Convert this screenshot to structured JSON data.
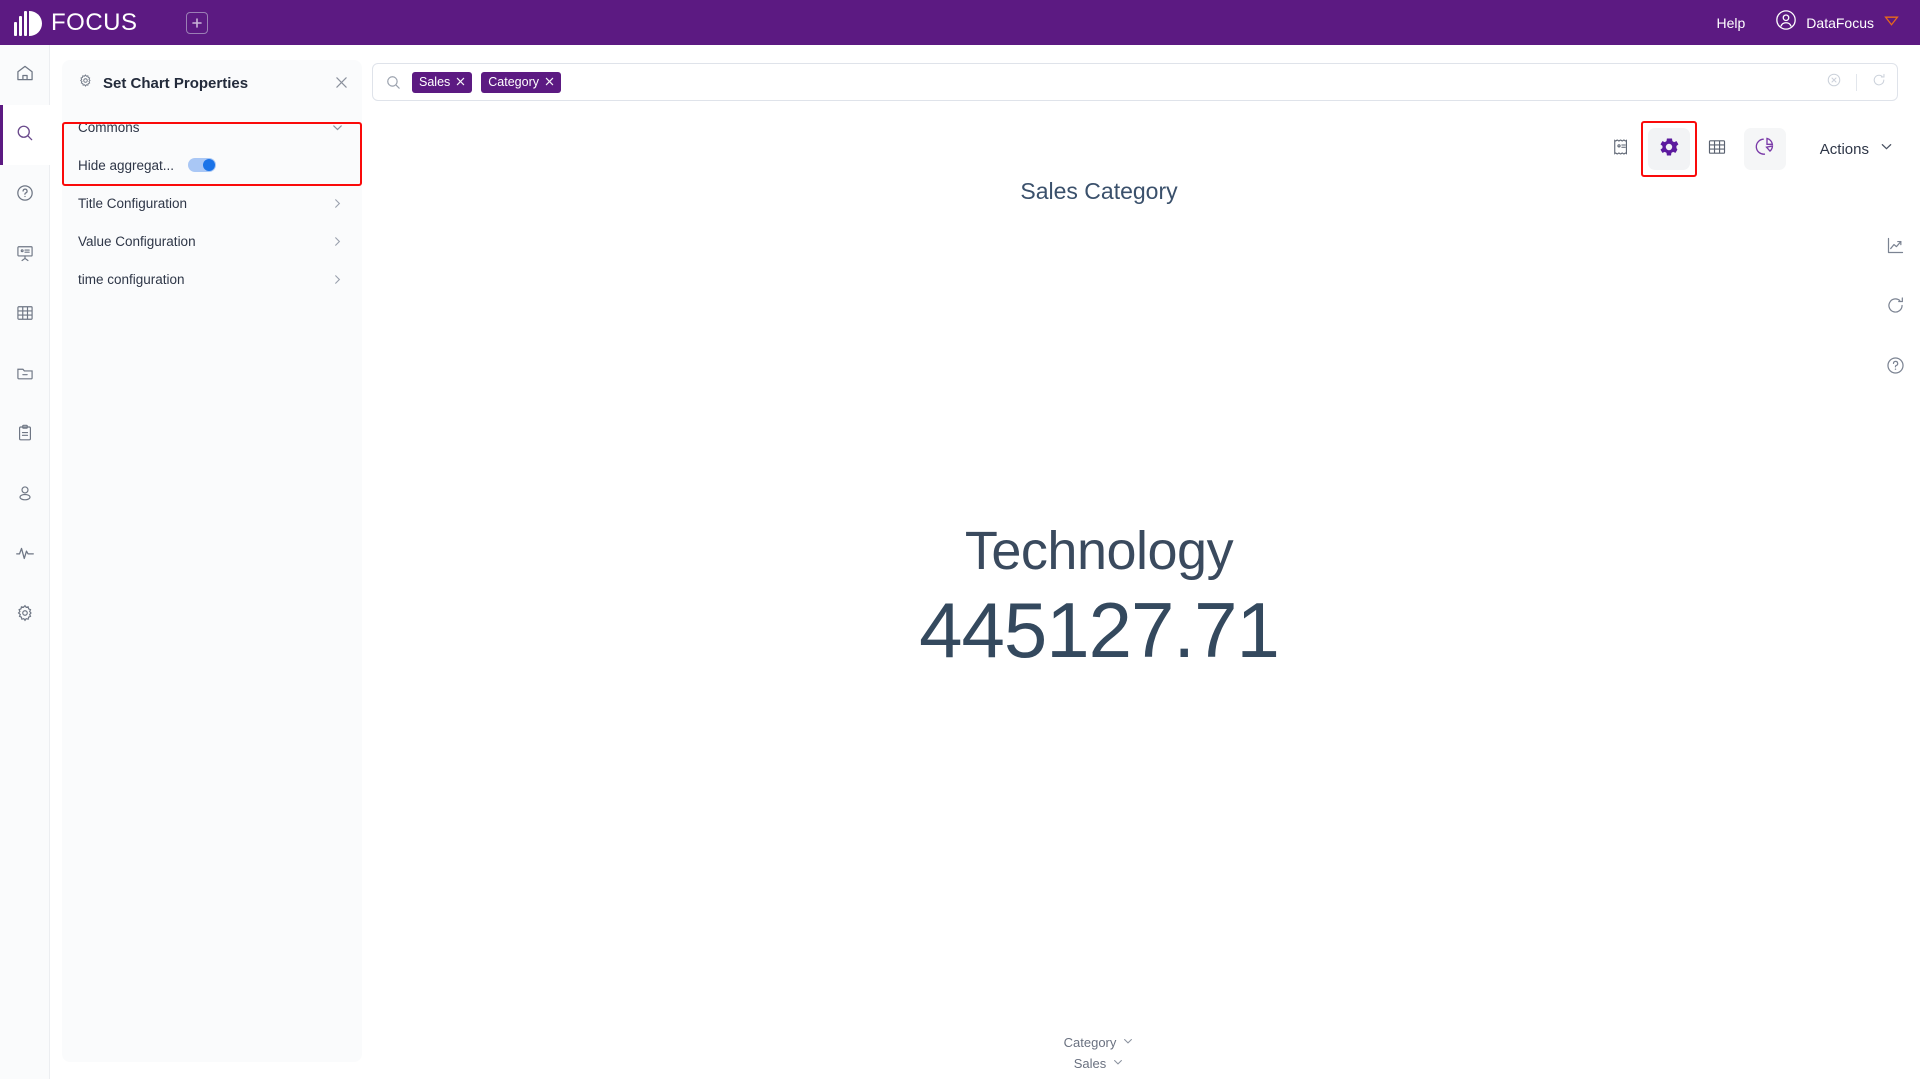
{
  "topbar": {
    "brand_name": "FOCUS",
    "add_tab_icon": "plus-square-icon",
    "help_label": "Help",
    "account_name": "DataFocus",
    "account_icon": "user-circle-icon",
    "account_badge_icon": "diamond-badge-icon",
    "background_color": "#5c1a82"
  },
  "rail": {
    "items": [
      {
        "icon": "home-icon",
        "active": false
      },
      {
        "icon": "search-icon",
        "active": true
      },
      {
        "icon": "question-circle-icon",
        "active": false
      },
      {
        "icon": "presentation-icon",
        "active": false
      },
      {
        "icon": "table-grid-icon",
        "active": false
      },
      {
        "icon": "folder-minus-icon",
        "active": false
      },
      {
        "icon": "clipboard-icon",
        "active": false
      },
      {
        "icon": "user-icon",
        "active": false
      },
      {
        "icon": "pulse-icon",
        "active": false
      },
      {
        "icon": "gear-icon",
        "active": false
      }
    ]
  },
  "properties_panel": {
    "title": "Set Chart Properties",
    "title_icon": "gear-icon",
    "close_icon": "close-icon",
    "commons": {
      "label": "Commons",
      "chevron": "chevron-down-icon",
      "expanded": true,
      "toggle_label": "Hide aggregat...",
      "toggle_on": true,
      "toggle_track_color": "#a9c7f5",
      "toggle_knob_color": "#1a73e8"
    },
    "sections": [
      {
        "label": "Title Configuration",
        "chevron": "chevron-right-icon"
      },
      {
        "label": "Value Configuration",
        "chevron": "chevron-right-icon"
      },
      {
        "label": "time configuration",
        "chevron": "chevron-right-icon"
      }
    ],
    "highlight_color": "#fa0a0a"
  },
  "search": {
    "icon": "search-icon",
    "placeholder": "",
    "chips": [
      {
        "label": "Sales",
        "remove_icon": "close-icon"
      },
      {
        "label": "Category",
        "remove_icon": "close-icon"
      }
    ],
    "clear_icon": "clear-circle-icon",
    "refresh_icon": "refresh-icon",
    "chip_color": "#5c1a82"
  },
  "chart_toolbar": {
    "buttons": [
      {
        "name": "formula-icon",
        "label": "",
        "selected": false,
        "soft": false
      },
      {
        "name": "gear-icon",
        "label": "",
        "selected": true,
        "soft": false
      },
      {
        "name": "table-grid-icon",
        "label": "",
        "selected": false,
        "soft": false
      },
      {
        "name": "pie-chart-icon",
        "label": "",
        "selected": false,
        "soft": true
      }
    ],
    "actions_label": "Actions",
    "actions_chevron": "chevron-down-icon",
    "highlight_color": "#fa0a0a"
  },
  "right_float": {
    "icons": [
      "trend-chart-icon",
      "refresh-icon",
      "question-circle-icon"
    ]
  },
  "main": {
    "chart_title": "Sales Category",
    "kpi_name": "Technology",
    "kpi_value": "445127.71",
    "legend": [
      {
        "label": "Category",
        "chevron": "chevron-down-icon"
      },
      {
        "label": "Sales",
        "chevron": "chevron-down-icon"
      }
    ]
  },
  "chart_data": {
    "type": "table",
    "title": "Sales Category",
    "categories": [
      "Technology"
    ],
    "values": [
      445127.71
    ],
    "xlabel": "Category",
    "ylabel": "Sales"
  }
}
